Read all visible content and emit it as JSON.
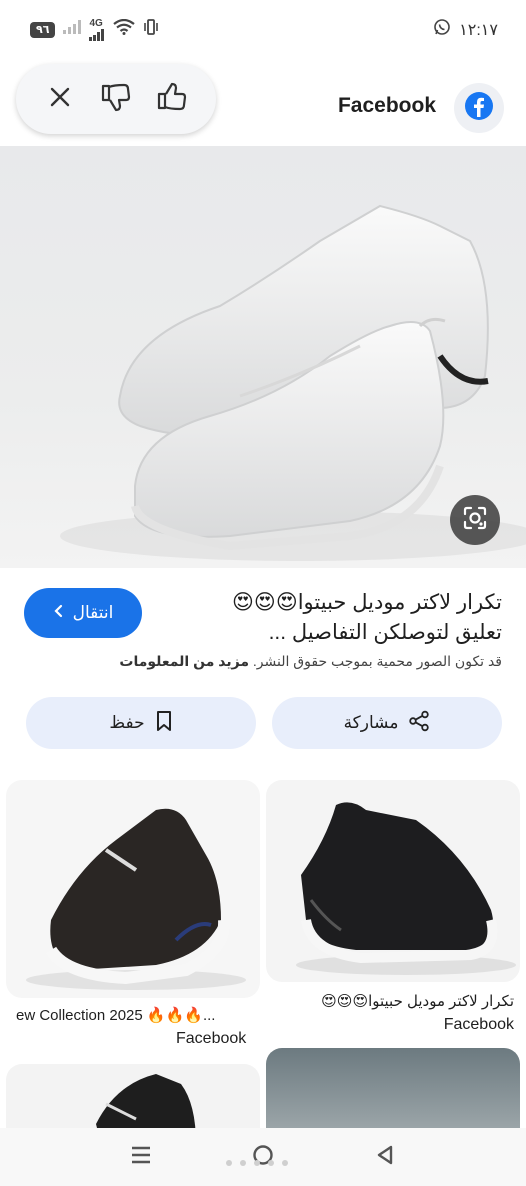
{
  "status_bar": {
    "battery": "٩٦",
    "network": "4G",
    "time": "١٢:١٧"
  },
  "header": {
    "source_name": "Facebook",
    "icons": [
      "close-icon",
      "thumbs-down-icon",
      "thumbs-up-icon",
      "facebook-logo-icon"
    ]
  },
  "main": {
    "title_line1": "تكرار لاكتر موديل حبيتوا😍😍😍",
    "title_line2": "تعليق لتوصلكن التفاصيل ...",
    "visit_label": "انتقال",
    "copyright_text": "قد تكون الصور محمية بموجب حقوق النشر.",
    "learn_more": "مزيد من المعلومات",
    "share_label": "مشاركة",
    "save_label": "حفظ"
  },
  "related": [
    {
      "caption": "تكرار لاكتر موديل حبيتوا😍😍😍",
      "source": "Facebook"
    },
    {
      "caption": "ew Collection 2025 🔥🔥🔥...",
      "source": "Facebook"
    }
  ],
  "colors": {
    "accent": "#1a73e8",
    "button_bg": "#e8eefb",
    "facebook_blue": "#1877f2"
  }
}
